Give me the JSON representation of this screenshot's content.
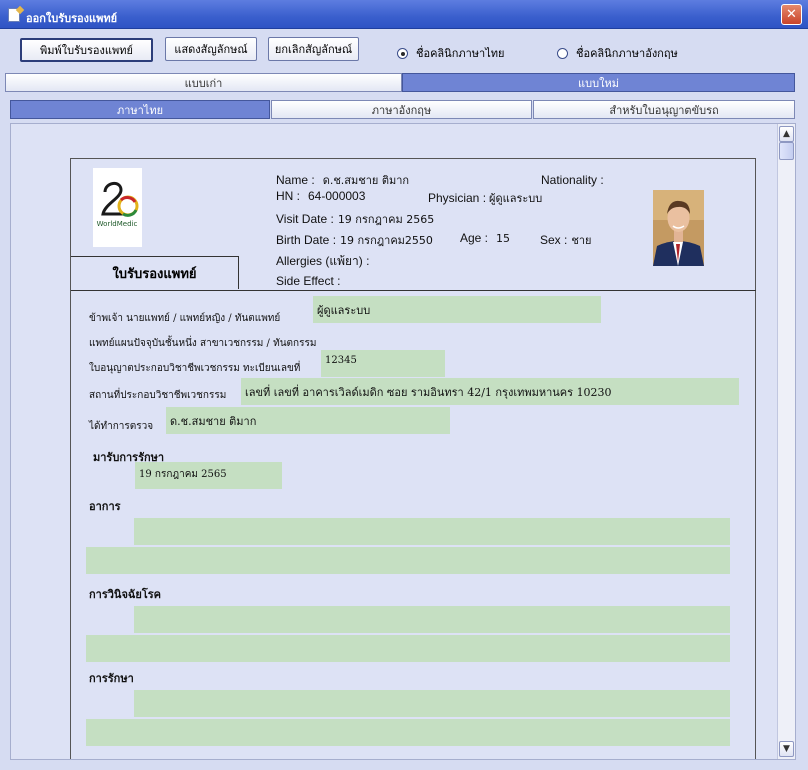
{
  "window": {
    "title": "ออกใบรับรองแพทย์",
    "close": "✕"
  },
  "toolbar": {
    "print_label": "พิมพ์ใบรับรองแพทย์",
    "show_sig_label": "แสดงสัญลักษณ์",
    "cancel_sig_label": "ยกเลิกสัญลักษณ์",
    "radio_thai": {
      "label": "ชื่อคลินิกภาษาไทย",
      "checked": true
    },
    "radio_eng": {
      "label": "ชื่อคลินิกภาษาอังกฤษ",
      "checked": false
    }
  },
  "tabs_top": [
    {
      "label": "แบบเก่า",
      "active": false
    },
    {
      "label": "แบบใหม่",
      "active": true
    }
  ],
  "tabs_lang": [
    {
      "label": "ภาษาไทย",
      "active": true
    },
    {
      "label": "ภาษาอังกฤษ",
      "active": false
    },
    {
      "label": "สำหรับใบอนุญาตขับรถ",
      "active": false
    }
  ],
  "logo_text": "WorldMedic",
  "header": {
    "name_key": "Name :",
    "name_val": "ด.ช.สมชาย  ติมาก",
    "nationality_key": "Nationality :",
    "nationality_val": "",
    "hn_key": "HN :",
    "hn_val": "64-000003",
    "physician_key": "Physician :",
    "physician_val": "ผู้ดูแลระบบ",
    "visit_key": "Visit Date :",
    "visit_val": "19 กรกฎาคม 2565",
    "birth_key": "Birth Date :",
    "birth_val": "19 กรกฎาคม2550",
    "age_key": "Age :",
    "age_val": "15",
    "sex_key": "Sex :",
    "sex_val": "ชาย",
    "allergies_key": "Allergies (แพ้ยา) :",
    "allergies_val": "",
    "side_key": "Side Effect :",
    "side_val": ""
  },
  "cert_title": "ใบรับรองแพทย์",
  "form": {
    "doctor_label": "ข้าพเจ้า นายแพทย์ / แพทย์หญิง / ทันตแพทย์",
    "doctor_value": "ผู้ดูแลระบบ",
    "dept_label": "แพทย์แผนปัจจุบันชั้นหนึ่ง สาขาเวชกรรม / ทันตกรรม",
    "license_label": "ใบอนุญาตประกอบวิชาชีพเวชกรรม ทะเบียนเลขที่",
    "license_value": "12345",
    "place_label": "สถานที่ประกอบวิชาชีพเวชกรรม",
    "place_value": "เลขที่ เลขที่ อาคารเวิลด์เมดิก ซอย รามอินทรา 42/1 กรุงเทพมหานคร 10230",
    "examined_label": "ได้ทำการตรวจ",
    "examined_value": "ด.ช.สมชาย  ติมาก",
    "came_label": "มารับการรักษา",
    "came_value": "19 กรกฎาคม 2565",
    "symptom_label": "อาการ",
    "diagnosis_label": "การวินิจฉัยโรค",
    "treatment_label": "การรักษา"
  },
  "colors": {
    "field_bg": "#c5dfc2",
    "tab_active": "#6f84d4",
    "title_bar": "#3a5fcd"
  }
}
